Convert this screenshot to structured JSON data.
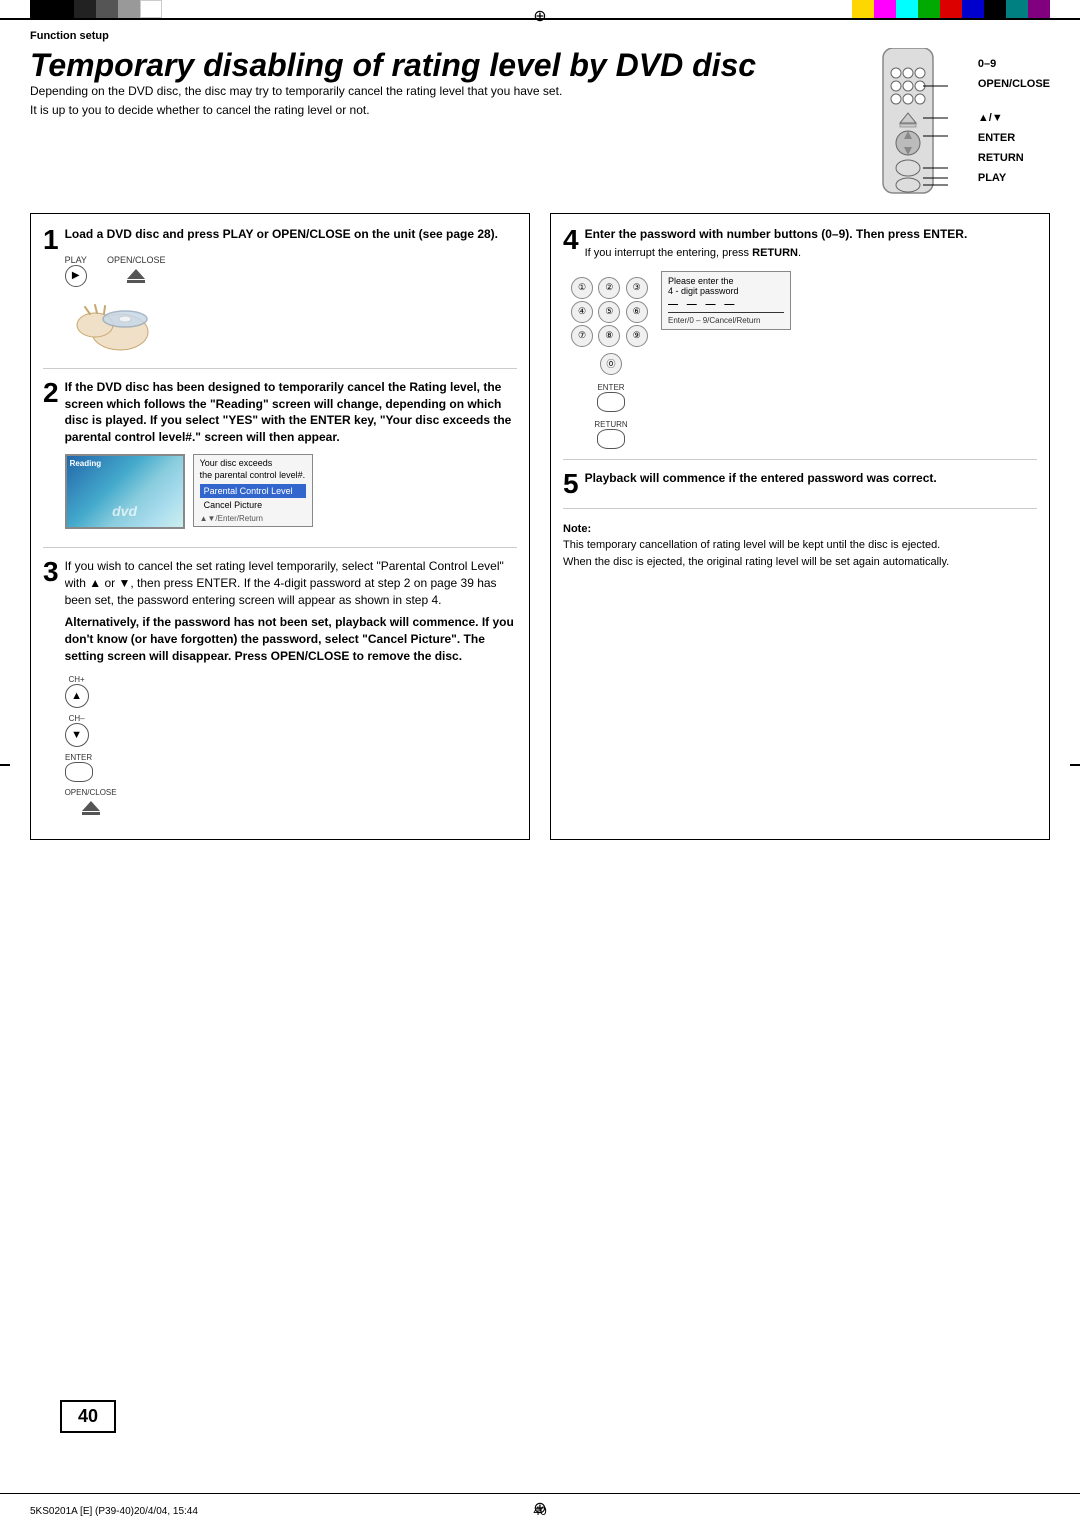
{
  "page": {
    "number": "40",
    "footer_left": "5KS0201A [E] (P39-40)",
    "footer_center": "40",
    "footer_right": "20/4/04, 15:44"
  },
  "header": {
    "function_setup": "Function setup"
  },
  "title": {
    "main": "Temporary disabling of rating level by DVD disc",
    "sub1": "Depending on the DVD disc, the disc may try to temporarily cancel the rating level that you have set.",
    "sub2": "It is up to you to decide whether to cancel the rating level or not."
  },
  "remote": {
    "label_09": "0–9",
    "label_openclose": "OPEN/CLOSE",
    "label_updown": "▲/▼",
    "label_enter": "ENTER",
    "label_return": "RETURN",
    "label_play": "PLAY"
  },
  "steps": {
    "step1": {
      "number": "1",
      "text_bold": "Load a DVD disc and press PLAY or OPEN/CLOSE on the unit (see page 28).",
      "play_label": "PLAY",
      "openclose_label": "OPEN/CLOSE"
    },
    "step2": {
      "number": "2",
      "text": "If the DVD disc has been designed to temporarily cancel the Rating level, the screen which follows the \"Reading\" screen will change, depending on which disc is played. If you select \"YES\" with the ENTER key, \"Your disc exceeds the parental control level#.\" screen will then appear.",
      "screen_label": "Reading",
      "menu_title": "Your disc exceeds",
      "menu_subtitle": "the parental control level#.",
      "menu_item1": "Parental Control Level",
      "menu_item2": "Cancel Picture",
      "menu_arrows": "▲▼/Enter/Return"
    },
    "step3": {
      "number": "3",
      "text1": "If you wish to cancel the set rating level temporarily, select \"Parental Control Level\" with ▲ or ▼, then press ENTER. If the 4-digit password at step 2 on page 39 has been set, the password entering screen will appear as shown in step 4.",
      "text2_bold": "Alternatively, if the password has not been set, playback will commence. If you don't know (or have forgotten) the password, select \"Cancel Picture\". The setting screen will disappear. Press OPEN/CLOSE to remove the disc.",
      "btn_ch_up_label": "CH+",
      "btn_ch_down_label": "CH–",
      "btn_enter_label": "ENTER",
      "btn_openclose_label": "OPEN/CLOSE"
    },
    "step4": {
      "number": "4",
      "text_bold": "Enter the password with number buttons (0–9). Then press ENTER.",
      "interrupt_text": "If you interrupt the entering, press",
      "return_label": "RETURN",
      "num_buttons": [
        "①",
        "②",
        "③",
        "④",
        "⑤",
        "⑥",
        "⑦",
        "⑧",
        "⑨",
        "⓪"
      ],
      "enter_label": "ENTER",
      "return_btn_label": "RETURN",
      "password_box": {
        "line1": "Please enter the",
        "line2": "4 - digit password",
        "dashes": "— — — —",
        "hint": "Enter/0 – 9/Cancel/Return"
      }
    },
    "step5": {
      "number": "5",
      "text_bold": "Playback will commence if the entered password was correct."
    }
  },
  "note": {
    "label": "Note:",
    "line1": "This temporary cancellation of rating level will be kept until the disc is ejected.",
    "line2": "When the disc is ejected, the original rating level will be set again automatically."
  }
}
